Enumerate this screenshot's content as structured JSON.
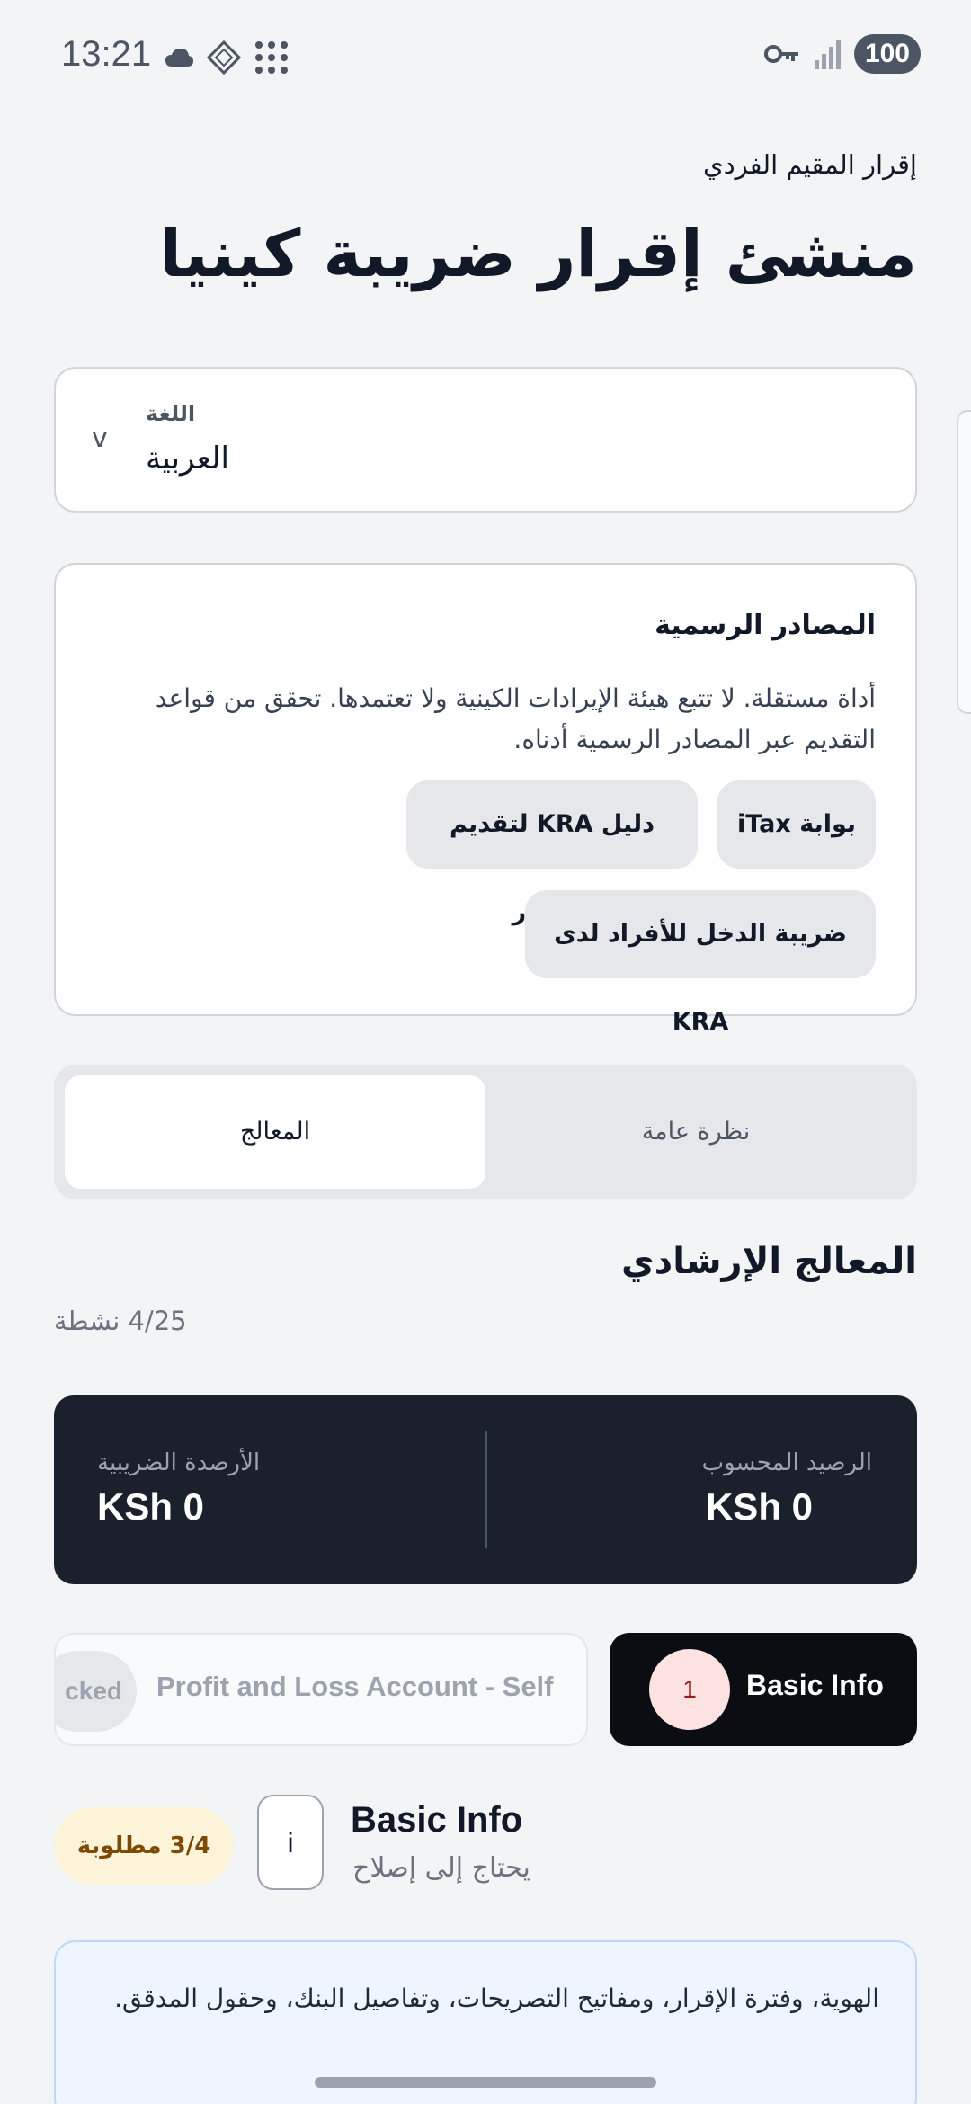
{
  "status_bar": {
    "time": "13:21",
    "battery": "100",
    "icons_left": [
      "cloud-icon",
      "diamond-grid-icon",
      "dots-grid-icon"
    ],
    "icons_right": [
      "key-icon",
      "signal-icon",
      "battery-icon"
    ]
  },
  "header": {
    "subtitle": "إقرار المقيم الفردي",
    "title": "منشئ إقرار ضريبة كينيا"
  },
  "language": {
    "label": "اللغة",
    "value": "العربية",
    "chevron": "v"
  },
  "sources": {
    "title": "المصادر الرسمية",
    "text": "أداة مستقلة. لا تتبع هيئة الإيرادات الكينية ولا تعتمدها. تحقق من قواعد التقديم عبر المصادر الرسمية أدناه.",
    "links": [
      "بوابة iTax",
      "دليل KRA لتقديم الإقرار",
      "ضريبة الدخل للأفراد لدى KRA"
    ]
  },
  "tabs": {
    "overview": "نظرة عامة",
    "wizard": "المعالج"
  },
  "wizard": {
    "title": "المعالج الإرشادي",
    "count": "4/25 نشطة"
  },
  "balances": {
    "computed_label": "الرصيد المحسوب",
    "computed_value": "KSh 0",
    "tax_label": "الأرصدة الضريبية",
    "tax_value": "KSh 0"
  },
  "steps": {
    "active_number": "1",
    "active_label": "Basic Info",
    "next_label": "Profit and Loss Account - Self",
    "next_badge": "cked"
  },
  "section": {
    "icon": "i",
    "title": "Basic Info",
    "status": "يحتاج إلى إصلاح",
    "required": "3/4 مطلوبة",
    "description": "الهوية، وفترة الإقرار، ومفاتيح التصريحات، وتفاصيل البنك، وحقول المدقق."
  },
  "colors": {
    "background": "#f3f4f6",
    "dark_card": "#1a202c",
    "active_step": "#0b0d12",
    "required_badge": "#fdf3d8",
    "info_card": "#eef5ff"
  }
}
